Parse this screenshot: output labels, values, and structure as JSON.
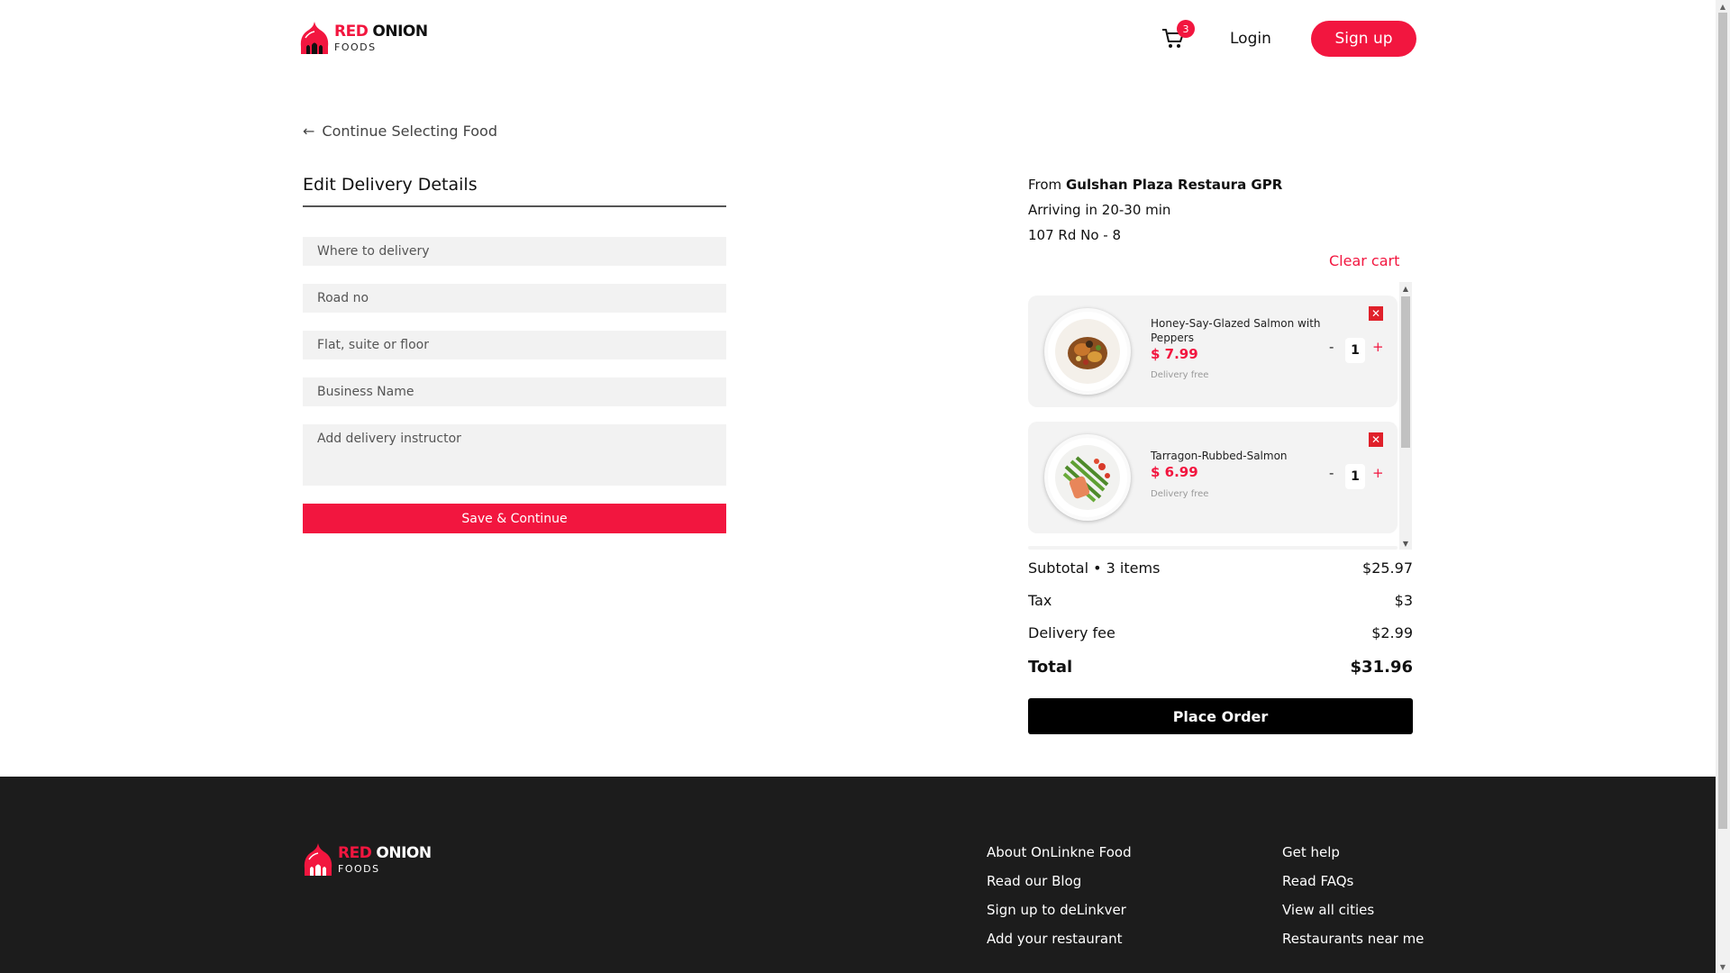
{
  "brand": {
    "name_red": "RED",
    "name_black": "ONION",
    "sub": "FOODS",
    "color": "#f2163f"
  },
  "header": {
    "cart_count": "3",
    "login_label": "Login",
    "signup_label": "Sign up"
  },
  "form": {
    "back_label": "Continue Selecting Food",
    "title": "Edit Delivery Details",
    "fields": [
      {
        "placeholder": "Where to delivery"
      },
      {
        "placeholder": "Road no"
      },
      {
        "placeholder": "Flat, suite or floor"
      },
      {
        "placeholder": "Business Name"
      },
      {
        "placeholder": "Add delivery instructor"
      }
    ],
    "save_label": "Save & Continue"
  },
  "order": {
    "from_prefix": "From",
    "restaurant": "Gulshan Plaza Restaura GPR",
    "arriving": "Arriving in 20-30 min",
    "address": "107 Rd No - 8",
    "clear_cart": "Clear cart",
    "items": [
      {
        "name": "Honey-Say-Glazed Salmon with Peppers",
        "price": "$ 7.99",
        "delivery": "Delivery free",
        "qty": "1"
      },
      {
        "name": "Tarragon-Rubbed-Salmon",
        "price": "$ 6.99",
        "delivery": "Delivery free",
        "qty": "1"
      }
    ],
    "subtotal_label": "Subtotal",
    "subtotal_items": "• 3 items",
    "subtotal_value": "$25.97",
    "tax_label": "Tax",
    "tax_value": "$3",
    "delivery_label": "Delivery fee",
    "delivery_value": "$2.99",
    "total_label": "Total",
    "total_value": "$31.96",
    "place_order": "Place Order"
  },
  "footer": {
    "col1": [
      "About OnLinkne Food",
      "Read our Blog",
      "Sign up to deLinkver",
      "Add your restaurant"
    ],
    "col2": [
      "Get help",
      "Read FAQs",
      "View all cities",
      "Restaurants near me"
    ]
  }
}
